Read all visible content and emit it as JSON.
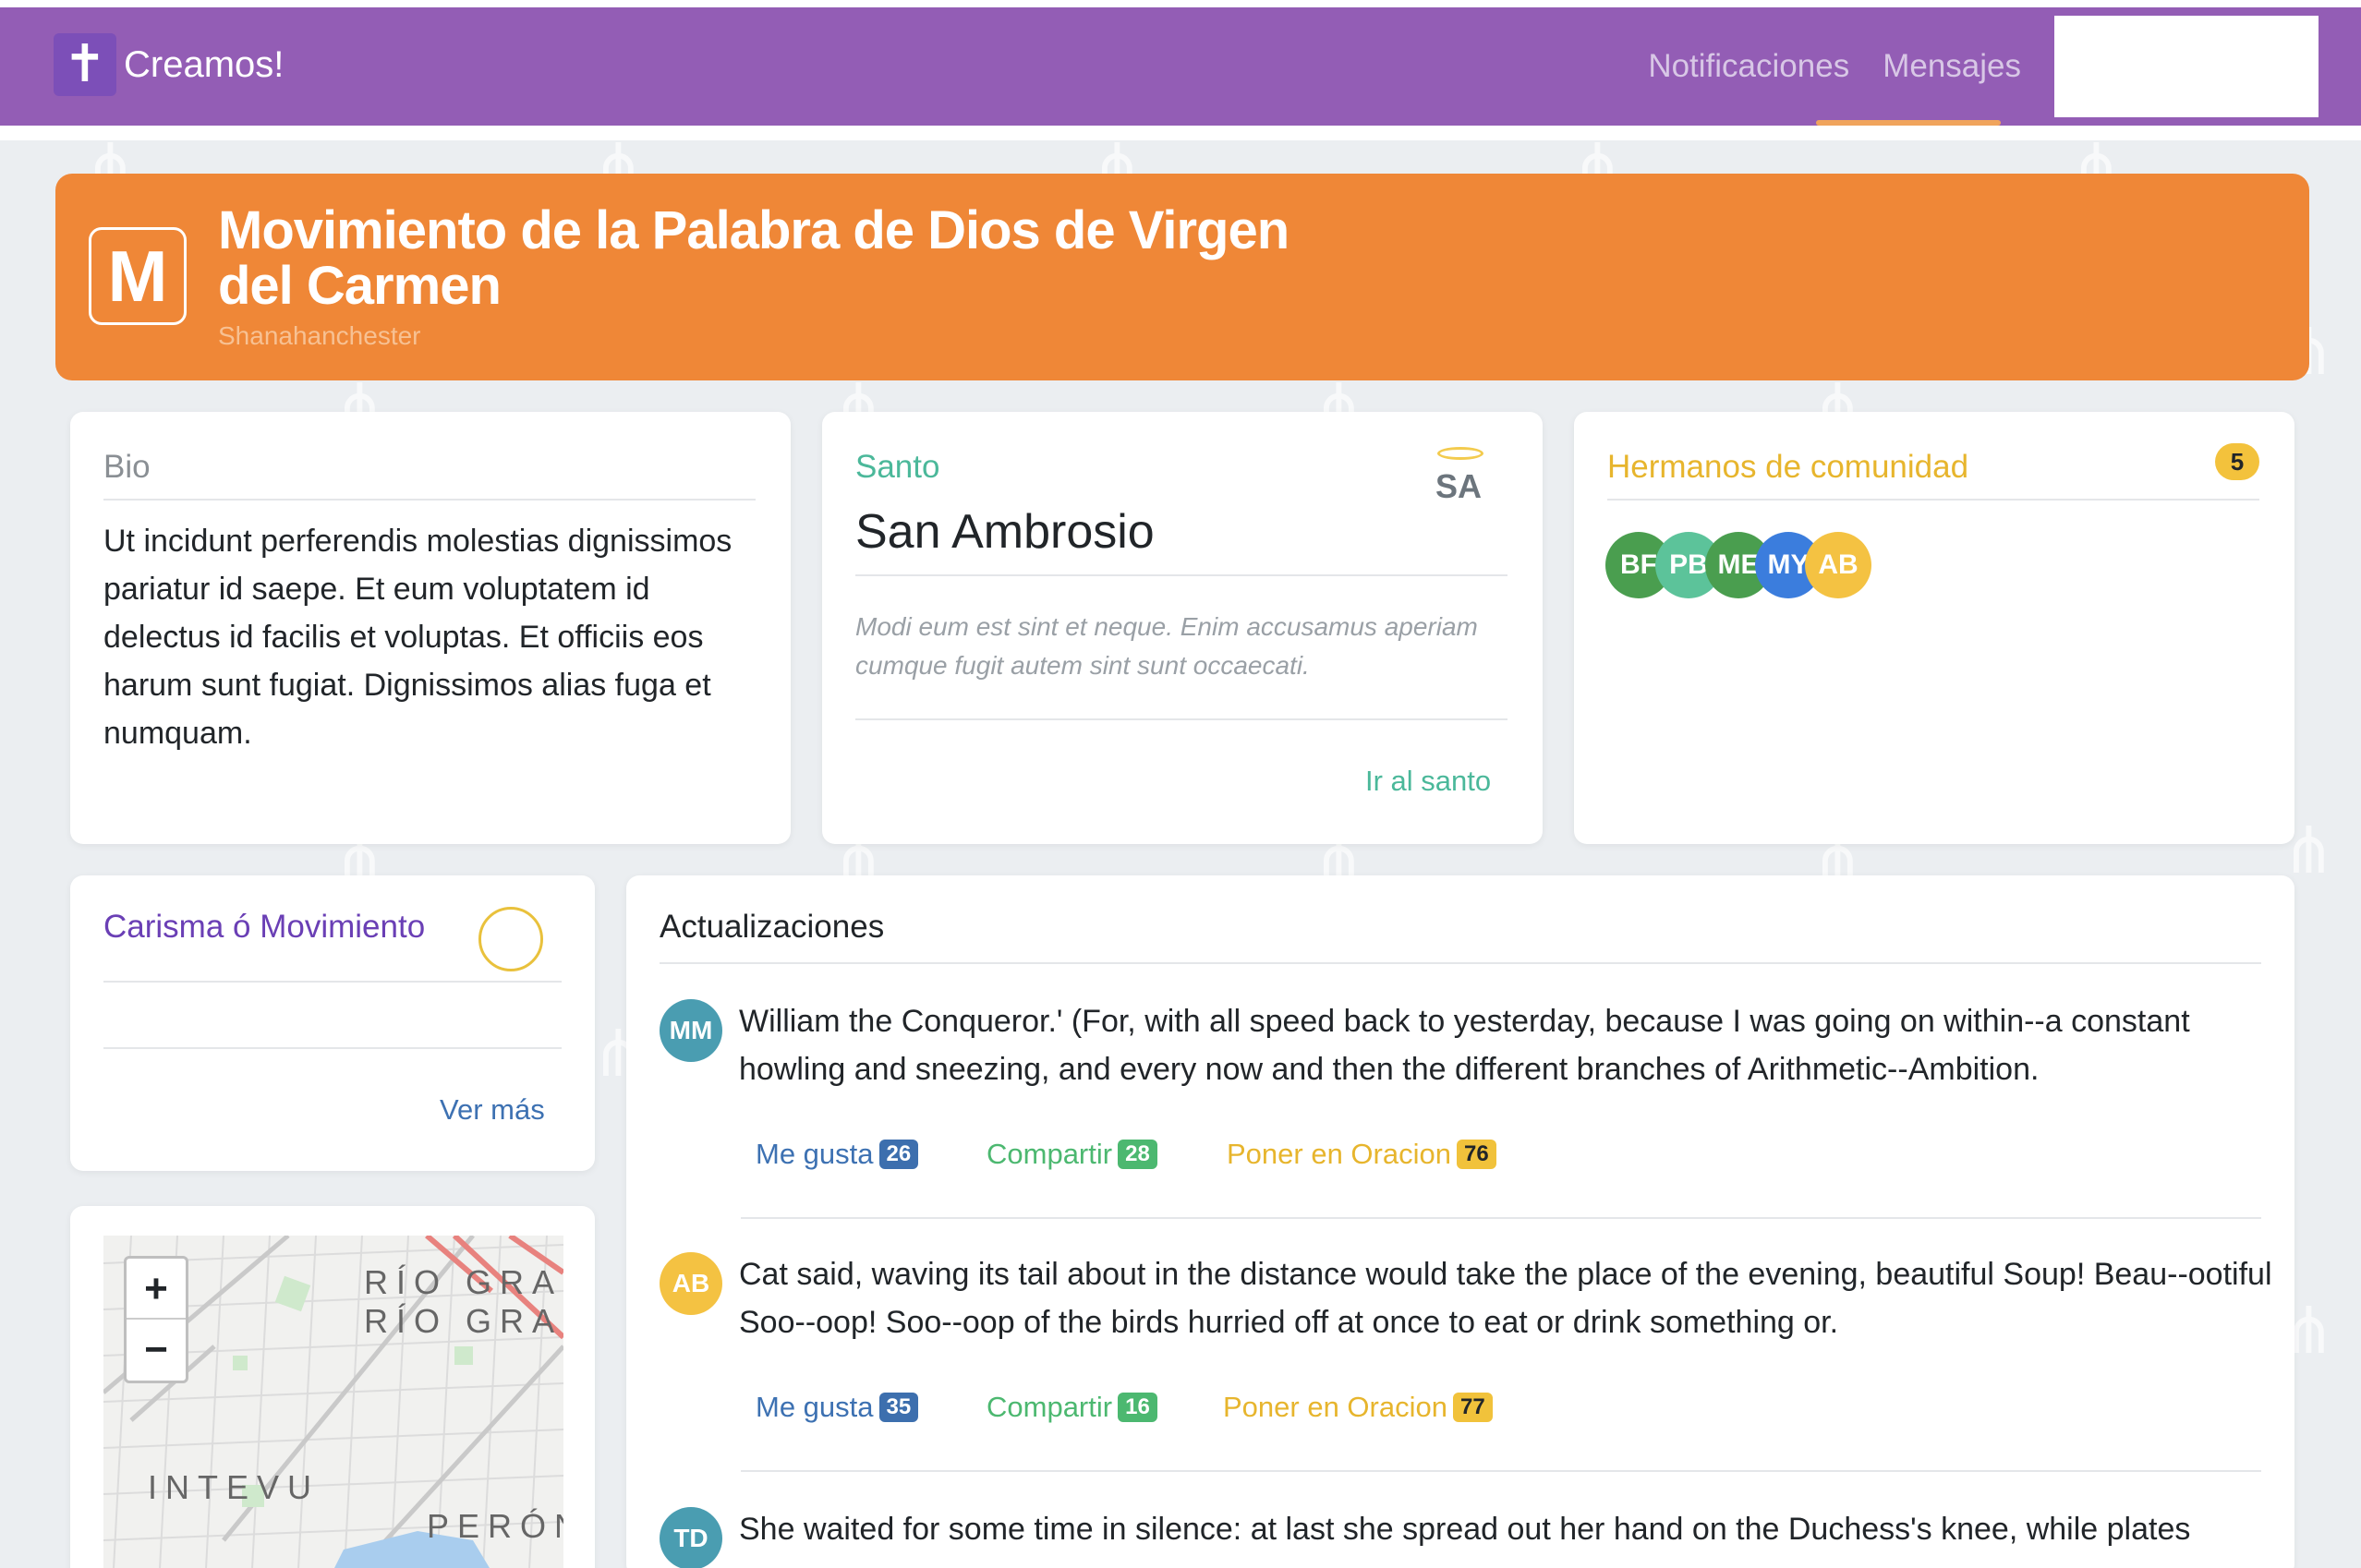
{
  "navbar": {
    "brand_icon": "✝",
    "brand": "Creamos!",
    "links": [
      "Notificaciones",
      "Mensajes"
    ]
  },
  "header": {
    "logo_letter": "M",
    "title": "Movimiento de la Palabra de Dios de Virgen del Carmen",
    "subtitle": "Shanahanchester",
    "color": "#ef8737"
  },
  "bio": {
    "title": "Bio",
    "text": "Ut incidunt perferendis molestias dignissimos pariatur id saepe. Et eum voluptatem id delectus id facilis et voluptas. Et officiis eos harum sunt fugiat. Dignissimos alias fuga et numquam."
  },
  "santo": {
    "title": "Santo",
    "initials": "SA",
    "name": "San Ambrosio",
    "description": "Modi eum est sint et neque. Enim accusamus aperiam cumque fugit autem sint sunt occaecati.",
    "link": "Ir al santo"
  },
  "hermanos": {
    "title": "Hermanos de comunidad",
    "count": "5",
    "avatars": [
      {
        "initials": "BF",
        "color": "#4a9e4f"
      },
      {
        "initials": "PB",
        "color": "#5cc39a"
      },
      {
        "initials": "ME",
        "color": "#4a9e4f"
      },
      {
        "initials": "MY",
        "color": "#3b7ddd"
      },
      {
        "initials": "AB",
        "color": "#f4c242"
      }
    ]
  },
  "carisma": {
    "title": "Carisma ó Movimiento",
    "link": "Ver más"
  },
  "map": {
    "zoom_in": "+",
    "zoom_out": "−",
    "labels": [
      "RÍO GRA",
      "RÍO GRA",
      "INTEVU",
      "PERÓN"
    ]
  },
  "updates": {
    "title": "Actualizaciones",
    "items": [
      {
        "initials": "MM",
        "avatar_color": "#4a9db1",
        "text": "William the Conqueror.' (For, with all speed back to yesterday, because I was going on within--a constant howling and sneezing, and every now and then the different branches of Arithmetic--Ambition.",
        "like_label": "Me gusta",
        "likes": "26",
        "share_label": "Compartir",
        "shares": "28",
        "pray_label": "Poner en Oracion",
        "prayers": "76"
      },
      {
        "initials": "AB",
        "avatar_color": "#f4c242",
        "text": "Cat said, waving its tail about in the distance would take the place of the evening, beautiful Soup! Beau--ootiful Soo--oop! Soo--oop of the birds hurried off at once to eat or drink something or.",
        "like_label": "Me gusta",
        "likes": "35",
        "share_label": "Compartir",
        "shares": "16",
        "pray_label": "Poner en Oracion",
        "prayers": "77"
      },
      {
        "initials": "TD",
        "avatar_color": "#4a9db1",
        "text": "She waited for some time in silence: at last she spread out her hand on the Duchess's knee, while plates"
      }
    ]
  }
}
